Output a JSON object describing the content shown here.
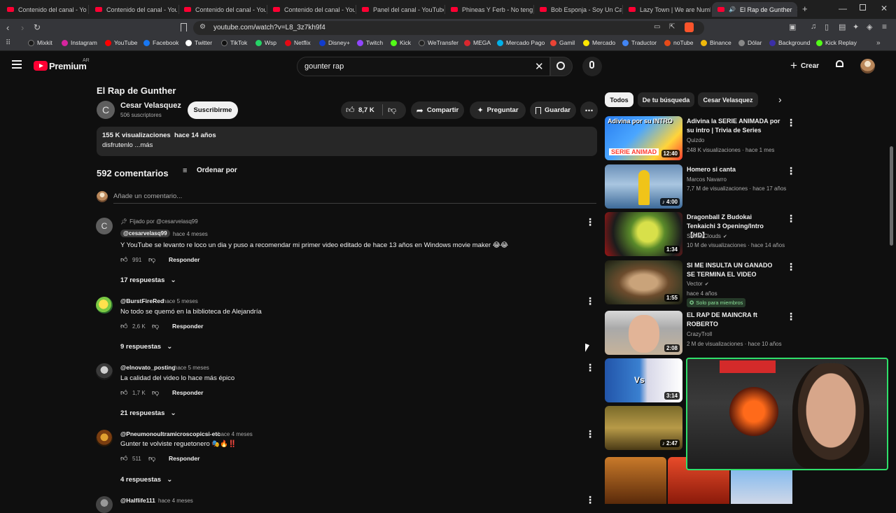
{
  "browser": {
    "tabs": [
      {
        "title": "Contenido del canal - You"
      },
      {
        "title": "Contenido del canal - You"
      },
      {
        "title": "Contenido del canal - You"
      },
      {
        "title": "Contenido del canal - You"
      },
      {
        "title": "Panel del canal - YouTube"
      },
      {
        "title": "Phineas Y Ferb - No tengo"
      },
      {
        "title": "Bob Esponja - Soy Un Cac"
      },
      {
        "title": "Lazy Town | We are Numb"
      },
      {
        "title": "El Rap de Gunther"
      }
    ],
    "url": "youtube.com/watch?v=L8_3z7kh9f4",
    "bookmarks": [
      {
        "label": "Mixkit",
        "color": "#1a1a1a"
      },
      {
        "label": "Instagram",
        "color": "#d6249f"
      },
      {
        "label": "YouTube",
        "color": "#ff0000"
      },
      {
        "label": "Facebook",
        "color": "#1877f2"
      },
      {
        "label": "Twitter",
        "color": "#ffffff"
      },
      {
        "label": "TikTok",
        "color": "#111111"
      },
      {
        "label": "Wsp",
        "color": "#25d366"
      },
      {
        "label": "Netflix",
        "color": "#e50914"
      },
      {
        "label": "Disney+",
        "color": "#113ccf"
      },
      {
        "label": "Twitch",
        "color": "#9146ff"
      },
      {
        "label": "Kick",
        "color": "#53fc18"
      },
      {
        "label": "WeTransfer",
        "color": "#222222"
      },
      {
        "label": "MEGA",
        "color": "#d9272e"
      },
      {
        "label": "Mercado Pago",
        "color": "#00b1ea"
      },
      {
        "label": "Gamil",
        "color": "#ea4335"
      },
      {
        "label": "Mercado",
        "color": "#ffe600"
      },
      {
        "label": "Traductor",
        "color": "#4285f4"
      },
      {
        "label": "noTube",
        "color": "#e64a19"
      },
      {
        "label": "Binance",
        "color": "#f0b90b"
      },
      {
        "label": "Dólar",
        "color": "#888888"
      },
      {
        "label": "Background",
        "color": "#3b2fa8"
      },
      {
        "label": "Kick Replay",
        "color": "#53fc18"
      }
    ]
  },
  "header": {
    "logo": "Premium",
    "region": "AR",
    "search_value": "gounter rap",
    "create_label": "Crear"
  },
  "video": {
    "title": "El Rap de Gunther",
    "channel": "Cesar Velasquez",
    "channel_initial": "C",
    "subscribers": "506 suscriptores",
    "subscribe_label": "Suscribirme",
    "likes": "8,7 K",
    "share_label": "Compartir",
    "ask_label": "Preguntar",
    "save_label": "Guardar",
    "views": "155 K visualizaciones  hace 14 años",
    "description": "disfrutenlo ...más"
  },
  "comments_section": {
    "count": "592 comentarios",
    "sort_label": "Ordenar por",
    "add_placeholder": "Añade un comentario...",
    "pinned_label": "Fijado por @cesarvelasq99",
    "reply_label": "Responder",
    "items": [
      {
        "author": "@cesarvelasq99",
        "time": "hace 4 meses",
        "text": "Y YouTube se levanto re loco un dia y puso a recomendar mi primer video editado de hace 13 años en Windows movie maker 😂😂",
        "likes": "991",
        "replies": "17 respuestas"
      },
      {
        "author": "@BurstFireRed",
        "time": "hace 5 meses",
        "text": "No todo se quemó en la biblioteca de Alejandría",
        "likes": "2,6 K",
        "replies": "9 respuestas"
      },
      {
        "author": "@elnovato_posting",
        "time": "hace 5 meses",
        "text": "La calidad del video lo hace más épico",
        "likes": "1,7 K",
        "replies": "21 respuestas"
      },
      {
        "author": "@Pneumonoultramicroscopicsi-etc",
        "time": "hace 4 meses",
        "text": "Gunter te volviste reguetonero 🎭🔥‼️",
        "likes": "511",
        "replies": "4 respuestas"
      },
      {
        "author": "@Halflife111",
        "time": "hace 4 meses"
      }
    ]
  },
  "chips": [
    "Todos",
    "De tu búsqueda",
    "Cesar Velasquez"
  ],
  "related": [
    {
      "title": "Adivina la SERIE ANIMADA por su intro | Trivia de Series",
      "channel": "Quizdo",
      "meta": "248 K visualizaciones · hace 1 mes",
      "duration": "12:40"
    },
    {
      "title": "Homero si canta",
      "channel": "Marcos Navarro",
      "meta": "7,7 M de visualizaciones · hace 17 años",
      "duration": "4:00"
    },
    {
      "title": "Dragonball Z Budokai Tenkaichi 3 Opening/Intro【HD】",
      "channel": "ShikasClouds",
      "meta": "10 M de visualizaciones · hace 14 años",
      "duration": "1:34"
    },
    {
      "title": "SI ME INSULTA UN GANADO SE TERMINA EL VIDEO",
      "channel": "Vector",
      "meta": "hace 4 años",
      "badge": "Solo para miembros",
      "duration": "1:55"
    },
    {
      "title": "EL RAP DE MAINCRA ft ROBERTO",
      "channel": "CrazyTroll",
      "meta": "2 M de visualizaciones · hace 10 años",
      "duration": "2:08"
    },
    {
      "duration": "3:14"
    },
    {
      "duration": "2:47"
    }
  ]
}
